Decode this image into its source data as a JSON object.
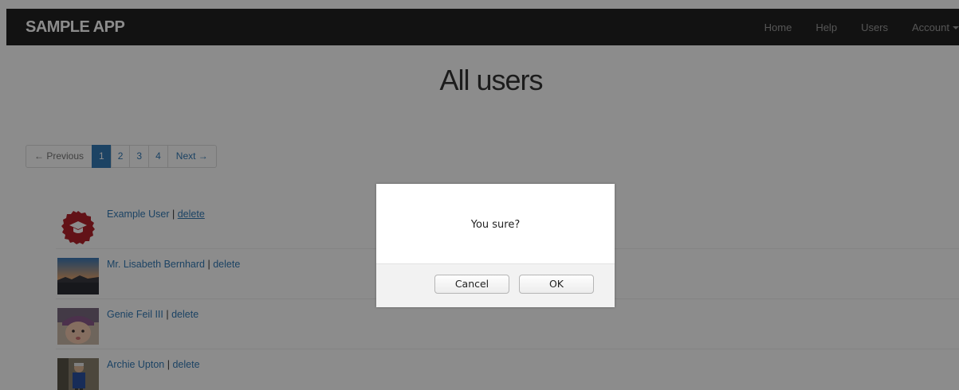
{
  "navbar": {
    "brand": "SAMPLE APP",
    "links": [
      "Home",
      "Help",
      "Users"
    ],
    "account_label": "Account"
  },
  "main": {
    "title": "All users",
    "pagination": {
      "previous": "← Previous",
      "pages": [
        "1",
        "2",
        "3",
        "4"
      ],
      "active_page": "1",
      "next": "Next →"
    },
    "users": [
      {
        "name": "Example User",
        "separator": "|",
        "action": "delete"
      },
      {
        "name": "Mr. Lisabeth Bernhard",
        "separator": "|",
        "action": "delete"
      },
      {
        "name": "Genie Feil III",
        "separator": "|",
        "action": "delete"
      },
      {
        "name": "Archie Upton",
        "separator": "|",
        "action": "delete"
      }
    ]
  },
  "dialog": {
    "message": "You sure?",
    "cancel_label": "Cancel",
    "ok_label": "OK"
  },
  "colors": {
    "navbar_bg": "#222222",
    "link": "#337ab7",
    "active_page_bg": "#337ab7",
    "overlay": "rgba(0,0,0,0.45)"
  }
}
